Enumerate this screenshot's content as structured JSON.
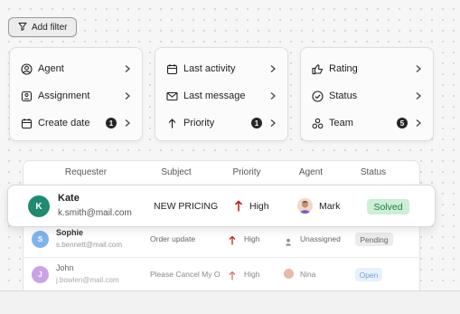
{
  "toolbar": {
    "add_filter_label": "Add filter",
    "filter_icon": "filter-icon"
  },
  "filter_cards": [
    {
      "items": [
        {
          "label": "Agent",
          "icon": "user-circle-icon",
          "count": null
        },
        {
          "label": "Assignment",
          "icon": "assignment-icon",
          "count": null
        },
        {
          "label": "Create date",
          "icon": "calendar-icon",
          "count": "1"
        }
      ]
    },
    {
      "items": [
        {
          "label": "Last activity",
          "icon": "calendar-icon",
          "count": null
        },
        {
          "label": "Last message",
          "icon": "mail-icon",
          "count": null
        },
        {
          "label": "Priority",
          "icon": "arrow-up-icon",
          "count": "1"
        }
      ]
    },
    {
      "items": [
        {
          "label": "Rating",
          "icon": "thumbs-up-icon",
          "count": null
        },
        {
          "label": "Status",
          "icon": "check-circle-icon",
          "count": null
        },
        {
          "label": "Team",
          "icon": "team-icon",
          "count": "5"
        }
      ]
    }
  ],
  "table": {
    "headers": [
      "Requester",
      "Subject",
      "Priority",
      "Agent",
      "Status"
    ],
    "rows": [
      {
        "initial": "K",
        "name": "Kate",
        "email": "k.smith@mail.com",
        "subject": "NEW PRICING",
        "priority": "High",
        "agent": "Mark",
        "status": "Solved"
      },
      {
        "initial": "S",
        "name": "Sophie",
        "email": "s.bennett@mail.com",
        "subject": "Order update",
        "priority": "High",
        "agent": "Unassigned",
        "status": "Pending"
      },
      {
        "initial": "J",
        "name": "John",
        "email": "j.bowlen@mail.com",
        "subject": "Please Cancel My O",
        "priority": "High",
        "agent": "Nina",
        "status": "Open"
      }
    ]
  },
  "colors": {
    "kate_avatar": "#1f8a70",
    "sophie_avatar": "#7fb3f0",
    "john_avatar": "#c9a3e6",
    "priority_arrow": "#b3261e",
    "solved_bg": "#cdefd6",
    "solved_text": "#1e7a3b",
    "pending_bg": "#ececec",
    "open_bg": "#e7f1fb",
    "open_text": "#6fa5d8"
  }
}
